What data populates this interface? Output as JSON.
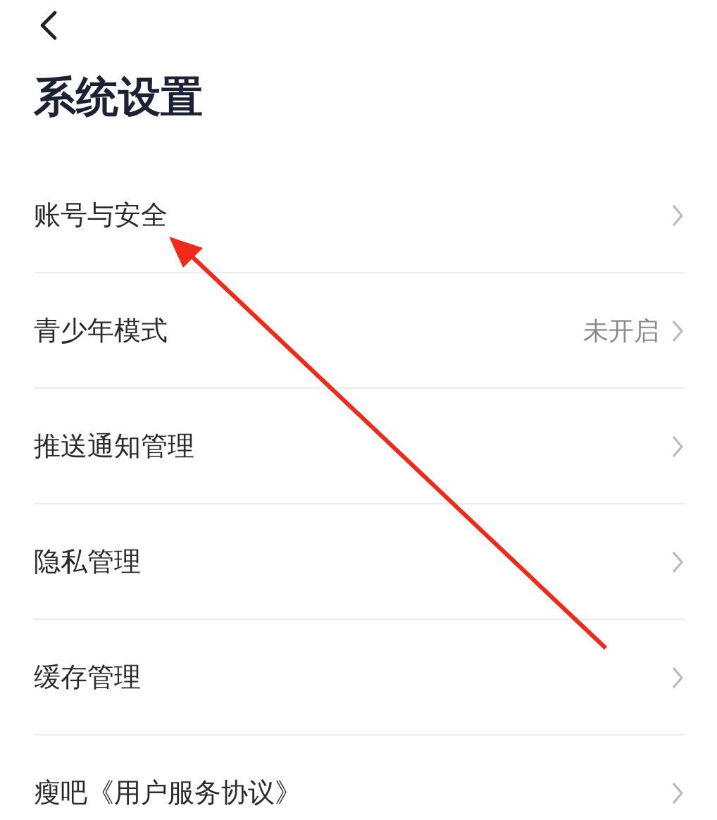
{
  "page": {
    "title": "系统设置"
  },
  "settings": [
    {
      "label": "账号与安全"
    },
    {
      "label": "青少年模式",
      "value": "未开启"
    },
    {
      "label": "推送通知管理"
    },
    {
      "label": "隐私管理"
    },
    {
      "label": "缓存管理"
    },
    {
      "label": "瘦吧《用户服务协议》"
    }
  ]
}
